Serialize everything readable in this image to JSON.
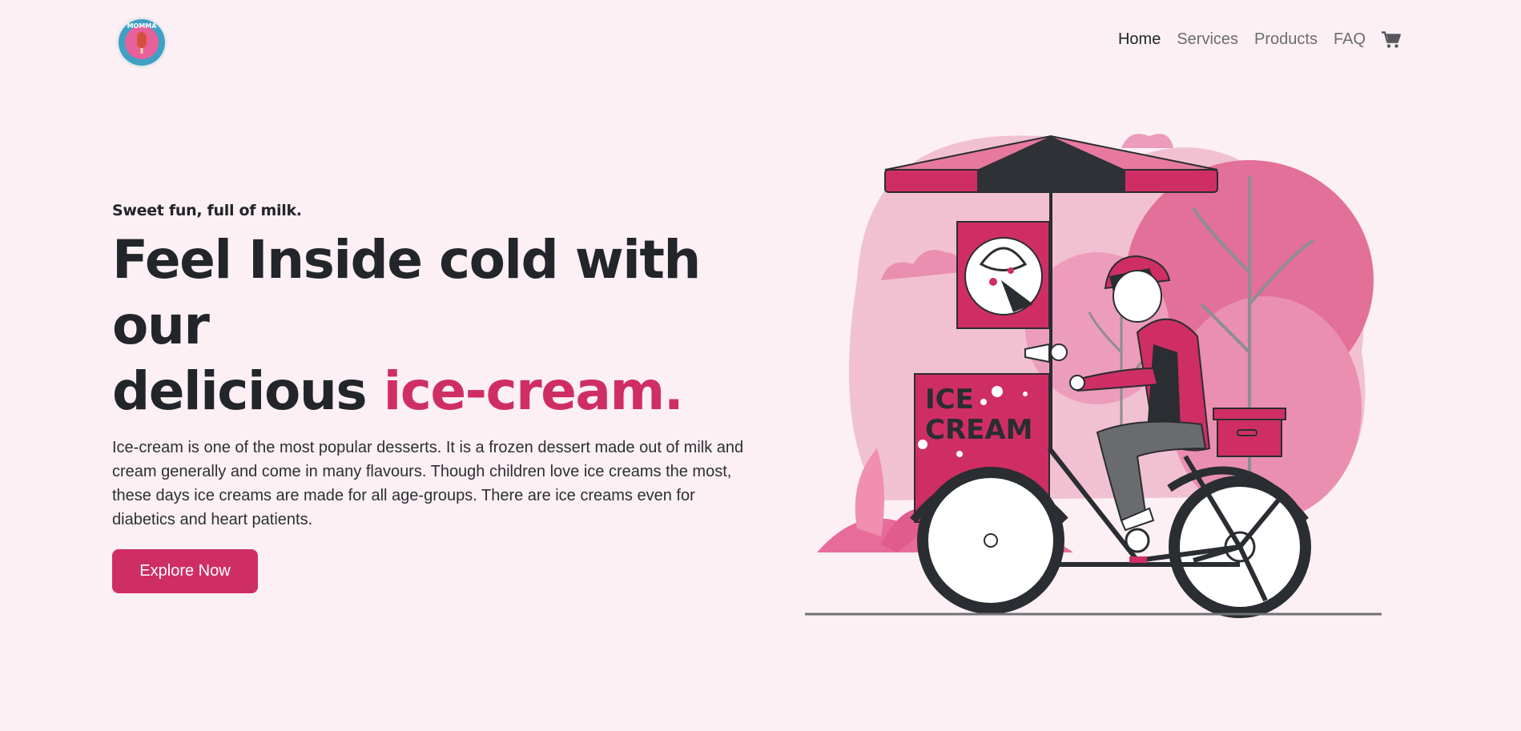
{
  "brand": {
    "logo_icon": "momma-ice-cream-logo",
    "logo_text": "MOMMA"
  },
  "nav": {
    "items": [
      {
        "label": "Home",
        "active": true
      },
      {
        "label": "Services",
        "active": false
      },
      {
        "label": "Products",
        "active": false
      },
      {
        "label": "FAQ",
        "active": false
      }
    ],
    "cart_icon": "shopping-cart-icon"
  },
  "hero": {
    "tagline": "Sweet fun, full of milk.",
    "headline_line1": "Feel Inside cold with our",
    "headline_line2": "delicious ",
    "headline_accent": "ice-cream.",
    "description": "Ice-cream is one of the most popular desserts. It is a frozen dessert made out of milk and cream generally and come in many flavours. Though children love ice creams the most, these days ice creams are made for all age-groups. There are ice creams even for diabetics and heart patients.",
    "cta_label": "Explore Now"
  },
  "illustration": {
    "sign_text_1": "ICE",
    "sign_text_2": "CREAM"
  },
  "colors": {
    "accent": "#cf2e64",
    "background": "#fcf0f4",
    "dark": "#22252a"
  }
}
